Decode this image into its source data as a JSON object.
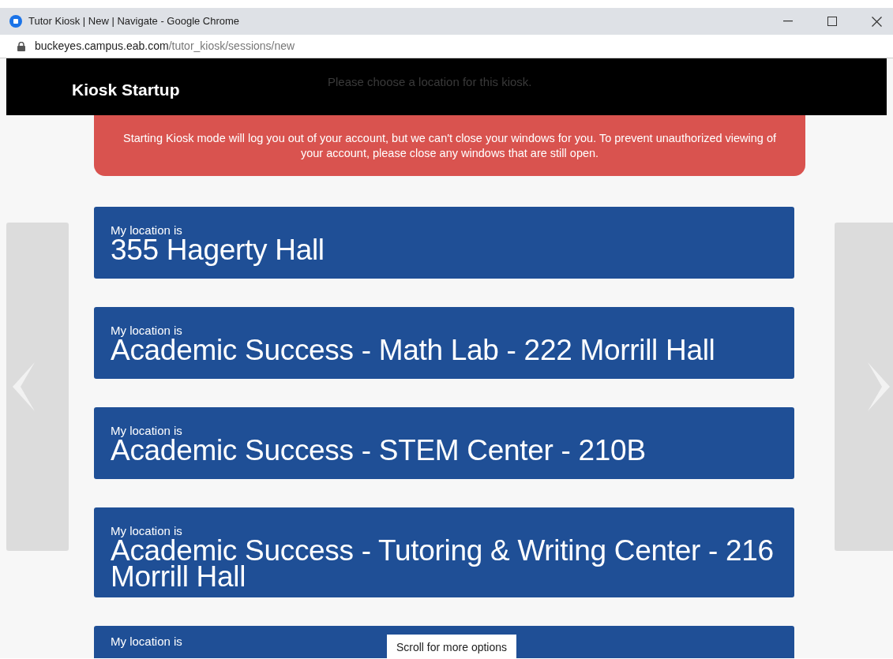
{
  "window": {
    "title": "Tutor Kiosk | New | Navigate - Google Chrome"
  },
  "address_bar": {
    "url_host": "buckeyes.campus.eab.com",
    "url_path": "/tutor_kiosk/sessions/new"
  },
  "header": {
    "title": "Kiosk Startup",
    "subtitle": "Please choose a location for this kiosk."
  },
  "warning": "Starting Kiosk mode will log you out of your account, but we can't close your windows for you. To prevent unauthorized viewing of your account, please close any windows that are still open.",
  "locations": [
    {
      "label": "My location is",
      "name": "355 Hagerty Hall"
    },
    {
      "label": "My location is",
      "name": "Academic Success - Math Lab - 222 Morrill Hall"
    },
    {
      "label": "My location is",
      "name": "Academic Success - STEM Center - 210B"
    },
    {
      "label": "My location is",
      "name": "Academic Success - Tutoring & Writing Center - 216 Morrill Hall"
    },
    {
      "label": "My location is"
    }
  ],
  "scroll_hint": "Scroll for more options"
}
